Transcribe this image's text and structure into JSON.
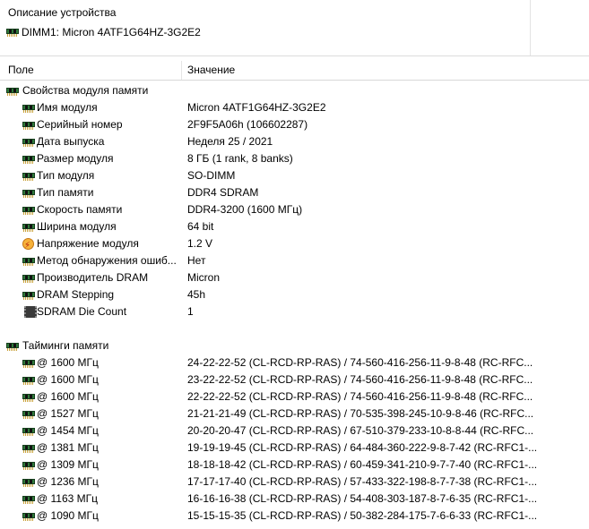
{
  "description": {
    "title": "Описание устройства",
    "device": "DIMM1: Micron 4ATF1G64HZ-3G2E2",
    "device_icon": "memory-module-icon"
  },
  "columns": {
    "field": "Поле",
    "value": "Значение"
  },
  "sections": {
    "properties": {
      "title": "Свойства модуля памяти",
      "items": [
        {
          "field": "Имя модуля",
          "value": "Micron 4ATF1G64HZ-3G2E2",
          "icon": "memory-module-icon"
        },
        {
          "field": "Серийный номер",
          "value": "2F9F5A06h (106602287)",
          "icon": "memory-module-icon"
        },
        {
          "field": "Дата выпуска",
          "value": "Неделя 25 / 2021",
          "icon": "memory-module-icon"
        },
        {
          "field": "Размер модуля",
          "value": "8 ГБ (1 rank, 8 banks)",
          "icon": "memory-module-icon"
        },
        {
          "field": "Тип модуля",
          "value": "SO-DIMM",
          "icon": "memory-module-icon"
        },
        {
          "field": "Тип памяти",
          "value": "DDR4 SDRAM",
          "icon": "memory-module-icon"
        },
        {
          "field": "Скорость памяти",
          "value": "DDR4-3200 (1600 МГц)",
          "icon": "memory-module-icon"
        },
        {
          "field": "Ширина модуля",
          "value": "64 bit",
          "icon": "memory-module-icon"
        },
        {
          "field": "Напряжение модуля",
          "value": "1.2 V",
          "icon": "voltage-icon"
        },
        {
          "field": "Метод обнаружения ошиб...",
          "value": "Нет",
          "icon": "memory-module-icon"
        },
        {
          "field": "Производитель DRAM",
          "value": "Micron",
          "icon": "memory-module-icon"
        },
        {
          "field": "DRAM Stepping",
          "value": "45h",
          "icon": "memory-module-icon"
        },
        {
          "field": "SDRAM Die Count",
          "value": "1",
          "icon": "chip-icon"
        }
      ]
    },
    "timings": {
      "title": "Тайминги памяти",
      "items": [
        {
          "field": "@ 1600 МГц",
          "value": "24-22-22-52  (CL-RCD-RP-RAS) / 74-560-416-256-11-9-8-48  (RC-RFC..."
        },
        {
          "field": "@ 1600 МГц",
          "value": "23-22-22-52  (CL-RCD-RP-RAS) / 74-560-416-256-11-9-8-48  (RC-RFC..."
        },
        {
          "field": "@ 1600 МГц",
          "value": "22-22-22-52  (CL-RCD-RP-RAS) / 74-560-416-256-11-9-8-48  (RC-RFC..."
        },
        {
          "field": "@ 1527 МГц",
          "value": "21-21-21-49  (CL-RCD-RP-RAS) / 70-535-398-245-10-9-8-46  (RC-RFC..."
        },
        {
          "field": "@ 1454 МГц",
          "value": "20-20-20-47  (CL-RCD-RP-RAS) / 67-510-379-233-10-8-8-44  (RC-RFC..."
        },
        {
          "field": "@ 1381 МГц",
          "value": "19-19-19-45  (CL-RCD-RP-RAS) / 64-484-360-222-9-8-7-42  (RC-RFC1-..."
        },
        {
          "field": "@ 1309 МГц",
          "value": "18-18-18-42  (CL-RCD-RP-RAS) / 60-459-341-210-9-7-7-40  (RC-RFC1-..."
        },
        {
          "field": "@ 1236 МГц",
          "value": "17-17-17-40  (CL-RCD-RP-RAS) / 57-433-322-198-8-7-7-38  (RC-RFC1-..."
        },
        {
          "field": "@ 1163 МГц",
          "value": "16-16-16-38  (CL-RCD-RP-RAS) / 54-408-303-187-8-7-6-35  (RC-RFC1-..."
        },
        {
          "field": "@ 1090 МГц",
          "value": "15-15-15-35  (CL-RCD-RP-RAS) / 50-382-284-175-7-6-6-33  (RC-RFC1-..."
        }
      ]
    }
  }
}
